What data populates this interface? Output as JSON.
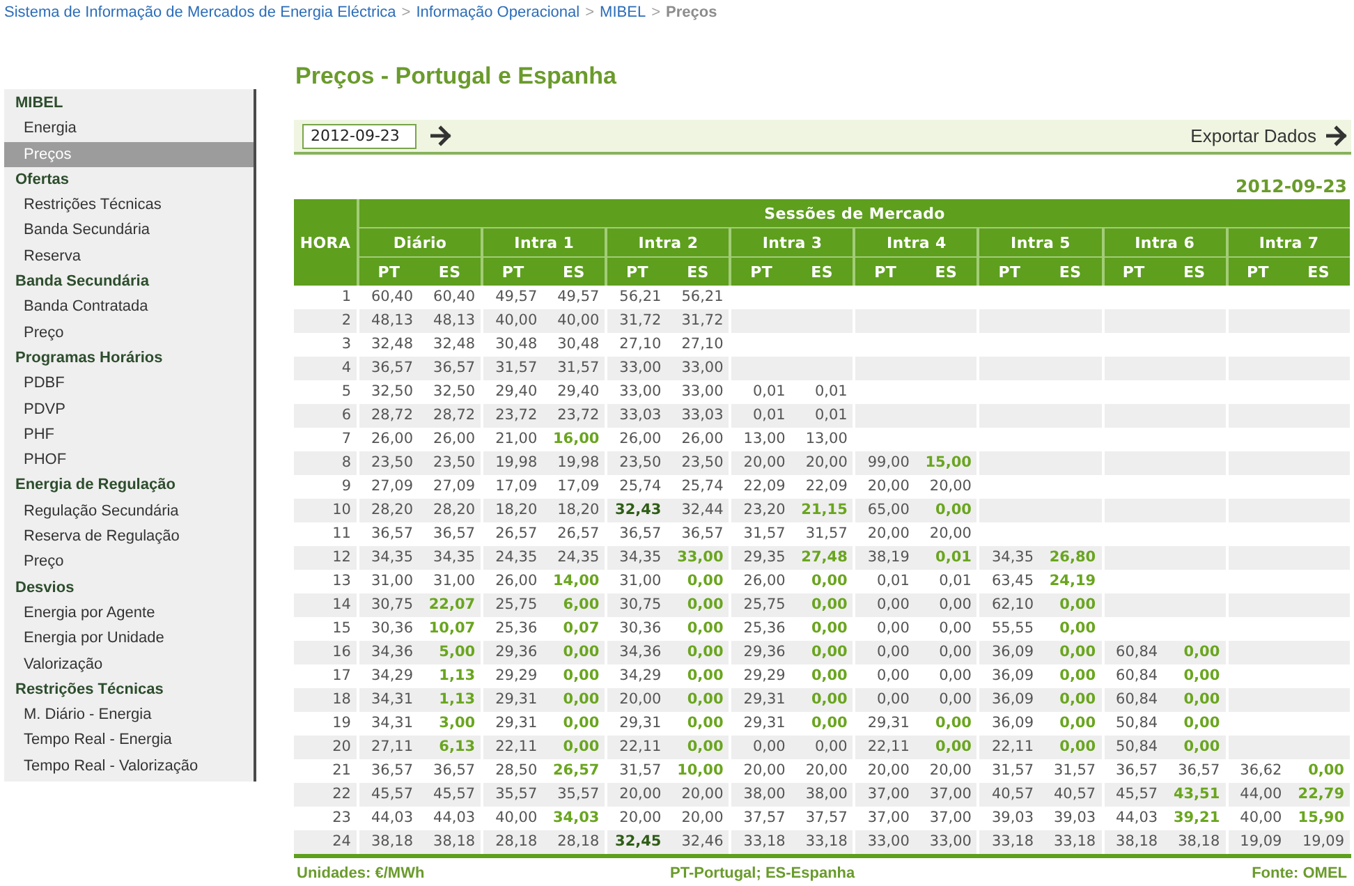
{
  "breadcrumb": [
    {
      "kind": "link",
      "label": "Sistema de Informação de Mercados de Energia Eléctrica"
    },
    {
      "kind": "separator",
      "label": ">"
    },
    {
      "kind": "link",
      "label": "Informação Operacional"
    },
    {
      "kind": "separator",
      "label": ">"
    },
    {
      "kind": "link",
      "label": "MIBEL"
    },
    {
      "kind": "separator",
      "label": ">"
    },
    {
      "kind": "current",
      "label": "Preços"
    }
  ],
  "sidebar": {
    "sections": [
      {
        "heading": "MIBEL",
        "items": [
          {
            "label": "Energia",
            "selected": false
          },
          {
            "label": "Preços",
            "selected": true
          }
        ]
      },
      {
        "heading": "Ofertas",
        "items": [
          {
            "label": "Restrições Técnicas",
            "selected": false
          },
          {
            "label": "Banda Secundária",
            "selected": false
          },
          {
            "label": "Reserva",
            "selected": false
          }
        ]
      },
      {
        "heading": "Banda Secundária",
        "items": [
          {
            "label": "Banda Contratada",
            "selected": false
          },
          {
            "label": "Preço",
            "selected": false
          }
        ]
      },
      {
        "heading": "Programas Horários",
        "items": [
          {
            "label": "PDBF",
            "selected": false
          },
          {
            "label": "PDVP",
            "selected": false
          },
          {
            "label": "PHF",
            "selected": false
          },
          {
            "label": "PHOF",
            "selected": false
          }
        ]
      },
      {
        "heading": "Energia de Regulação",
        "items": [
          {
            "label": "Regulação Secundária",
            "selected": false
          },
          {
            "label": "Reserva de Regulação",
            "selected": false
          },
          {
            "label": "Preço",
            "selected": false
          }
        ]
      },
      {
        "heading": "Desvios",
        "items": [
          {
            "label": "Energia por Agente",
            "selected": false
          },
          {
            "label": "Energia por Unidade",
            "selected": false
          },
          {
            "label": "Valorização",
            "selected": false
          }
        ]
      },
      {
        "heading": "Restrições Técnicas",
        "items": [
          {
            "label": "M. Diário - Energia",
            "selected": false
          },
          {
            "label": "Tempo Real - Energia",
            "selected": false
          },
          {
            "label": "Tempo Real - Valorização",
            "selected": false
          }
        ]
      }
    ]
  },
  "page_title": "Preços - Portugal e Espanha",
  "filter": {
    "date_field": {
      "value": "2012-09-23"
    },
    "export": {
      "label": "Exportar Dados"
    }
  },
  "table": {
    "date": "2012-09-23",
    "hour_header": "HORA",
    "group_header": "Sessões de Mercado",
    "sessions": [
      {
        "name": "Diário",
        "columns": [
          "PT",
          "ES"
        ]
      },
      {
        "name": "Intra 1",
        "columns": [
          "PT",
          "ES"
        ]
      },
      {
        "name": "Intra 2",
        "columns": [
          "PT",
          "ES"
        ]
      },
      {
        "name": "Intra 3",
        "columns": [
          "PT",
          "ES"
        ]
      },
      {
        "name": "Intra 4",
        "columns": [
          "PT",
          "ES"
        ]
      },
      {
        "name": "Intra 5",
        "columns": [
          "PT",
          "ES"
        ]
      },
      {
        "name": "Intra 6",
        "columns": [
          "PT",
          "ES"
        ]
      },
      {
        "name": "Intra 7",
        "columns": [
          "PT",
          "ES"
        ]
      }
    ],
    "rows": [
      {
        "hour": "1",
        "cells": [
          {
            "kind": "plain",
            "value": "60,40"
          },
          {
            "kind": "plain",
            "value": "60,40"
          },
          {
            "kind": "plain",
            "value": "49,57"
          },
          {
            "kind": "plain",
            "value": "49,57"
          },
          {
            "kind": "plain",
            "value": "56,21"
          },
          {
            "kind": "plain",
            "value": "56,21"
          }
        ]
      },
      {
        "hour": "2",
        "cells": [
          {
            "kind": "plain",
            "value": "48,13"
          },
          {
            "kind": "plain",
            "value": "48,13"
          },
          {
            "kind": "plain",
            "value": "40,00"
          },
          {
            "kind": "plain",
            "value": "40,00"
          },
          {
            "kind": "plain",
            "value": "31,72"
          },
          {
            "kind": "plain",
            "value": "31,72"
          }
        ]
      },
      {
        "hour": "3",
        "cells": [
          {
            "kind": "plain",
            "value": "32,48"
          },
          {
            "kind": "plain",
            "value": "32,48"
          },
          {
            "kind": "plain",
            "value": "30,48"
          },
          {
            "kind": "plain",
            "value": "30,48"
          },
          {
            "kind": "plain",
            "value": "27,10"
          },
          {
            "kind": "plain",
            "value": "27,10"
          }
        ]
      },
      {
        "hour": "4",
        "cells": [
          {
            "kind": "plain",
            "value": "36,57"
          },
          {
            "kind": "plain",
            "value": "36,57"
          },
          {
            "kind": "plain",
            "value": "31,57"
          },
          {
            "kind": "plain",
            "value": "31,57"
          },
          {
            "kind": "plain",
            "value": "33,00"
          },
          {
            "kind": "plain",
            "value": "33,00"
          }
        ]
      },
      {
        "hour": "5",
        "cells": [
          {
            "kind": "plain",
            "value": "32,50"
          },
          {
            "kind": "plain",
            "value": "32,50"
          },
          {
            "kind": "plain",
            "value": "29,40"
          },
          {
            "kind": "plain",
            "value": "29,40"
          },
          {
            "kind": "plain",
            "value": "33,00"
          },
          {
            "kind": "plain",
            "value": "33,00"
          },
          {
            "kind": "plain",
            "value": "0,01"
          },
          {
            "kind": "plain",
            "value": "0,01"
          }
        ]
      },
      {
        "hour": "6",
        "cells": [
          {
            "kind": "plain",
            "value": "28,72"
          },
          {
            "kind": "plain",
            "value": "28,72"
          },
          {
            "kind": "plain",
            "value": "23,72"
          },
          {
            "kind": "plain",
            "value": "23,72"
          },
          {
            "kind": "plain",
            "value": "33,03"
          },
          {
            "kind": "plain",
            "value": "33,03"
          },
          {
            "kind": "plain",
            "value": "0,01"
          },
          {
            "kind": "plain",
            "value": "0,01"
          }
        ]
      },
      {
        "hour": "7",
        "cells": [
          {
            "kind": "plain",
            "value": "26,00"
          },
          {
            "kind": "plain",
            "value": "26,00"
          },
          {
            "kind": "plain",
            "value": "21,00"
          },
          {
            "kind": "accent",
            "value": "16,00"
          },
          {
            "kind": "plain",
            "value": "26,00"
          },
          {
            "kind": "plain",
            "value": "26,00"
          },
          {
            "kind": "plain",
            "value": "13,00"
          },
          {
            "kind": "plain",
            "value": "13,00"
          }
        ]
      },
      {
        "hour": "8",
        "cells": [
          {
            "kind": "plain",
            "value": "23,50"
          },
          {
            "kind": "plain",
            "value": "23,50"
          },
          {
            "kind": "plain",
            "value": "19,98"
          },
          {
            "kind": "plain",
            "value": "19,98"
          },
          {
            "kind": "plain",
            "value": "23,50"
          },
          {
            "kind": "plain",
            "value": "23,50"
          },
          {
            "kind": "plain",
            "value": "20,00"
          },
          {
            "kind": "plain",
            "value": "20,00"
          },
          {
            "kind": "plain",
            "value": "99,00"
          },
          {
            "kind": "accent",
            "value": "15,00"
          }
        ]
      },
      {
        "hour": "9",
        "cells": [
          {
            "kind": "plain",
            "value": "27,09"
          },
          {
            "kind": "plain",
            "value": "27,09"
          },
          {
            "kind": "plain",
            "value": "17,09"
          },
          {
            "kind": "plain",
            "value": "17,09"
          },
          {
            "kind": "plain",
            "value": "25,74"
          },
          {
            "kind": "plain",
            "value": "25,74"
          },
          {
            "kind": "plain",
            "value": "22,09"
          },
          {
            "kind": "plain",
            "value": "22,09"
          },
          {
            "kind": "plain",
            "value": "20,00"
          },
          {
            "kind": "plain",
            "value": "20,00"
          }
        ]
      },
      {
        "hour": "10",
        "cells": [
          {
            "kind": "plain",
            "value": "28,20"
          },
          {
            "kind": "plain",
            "value": "28,20"
          },
          {
            "kind": "plain",
            "value": "18,20"
          },
          {
            "kind": "plain",
            "value": "18,20"
          },
          {
            "kind": "strong",
            "value": "32,43"
          },
          {
            "kind": "plain",
            "value": "32,44"
          },
          {
            "kind": "plain",
            "value": "23,20"
          },
          {
            "kind": "accent",
            "value": "21,15"
          },
          {
            "kind": "plain",
            "value": "65,00"
          },
          {
            "kind": "accent",
            "value": "0,00"
          }
        ]
      },
      {
        "hour": "11",
        "cells": [
          {
            "kind": "plain",
            "value": "36,57"
          },
          {
            "kind": "plain",
            "value": "36,57"
          },
          {
            "kind": "plain",
            "value": "26,57"
          },
          {
            "kind": "plain",
            "value": "26,57"
          },
          {
            "kind": "plain",
            "value": "36,57"
          },
          {
            "kind": "plain",
            "value": "36,57"
          },
          {
            "kind": "plain",
            "value": "31,57"
          },
          {
            "kind": "plain",
            "value": "31,57"
          },
          {
            "kind": "plain",
            "value": "20,00"
          },
          {
            "kind": "plain",
            "value": "20,00"
          }
        ]
      },
      {
        "hour": "12",
        "cells": [
          {
            "kind": "plain",
            "value": "34,35"
          },
          {
            "kind": "plain",
            "value": "34,35"
          },
          {
            "kind": "plain",
            "value": "24,35"
          },
          {
            "kind": "plain",
            "value": "24,35"
          },
          {
            "kind": "plain",
            "value": "34,35"
          },
          {
            "kind": "accent",
            "value": "33,00"
          },
          {
            "kind": "plain",
            "value": "29,35"
          },
          {
            "kind": "accent",
            "value": "27,48"
          },
          {
            "kind": "plain",
            "value": "38,19"
          },
          {
            "kind": "accent",
            "value": "0,01"
          },
          {
            "kind": "plain",
            "value": "34,35"
          },
          {
            "kind": "accent",
            "value": "26,80"
          }
        ]
      },
      {
        "hour": "13",
        "cells": [
          {
            "kind": "plain",
            "value": "31,00"
          },
          {
            "kind": "plain",
            "value": "31,00"
          },
          {
            "kind": "plain",
            "value": "26,00"
          },
          {
            "kind": "accent",
            "value": "14,00"
          },
          {
            "kind": "plain",
            "value": "31,00"
          },
          {
            "kind": "accent",
            "value": "0,00"
          },
          {
            "kind": "plain",
            "value": "26,00"
          },
          {
            "kind": "accent",
            "value": "0,00"
          },
          {
            "kind": "plain",
            "value": "0,01"
          },
          {
            "kind": "plain",
            "value": "0,01"
          },
          {
            "kind": "plain",
            "value": "63,45"
          },
          {
            "kind": "accent",
            "value": "24,19"
          }
        ]
      },
      {
        "hour": "14",
        "cells": [
          {
            "kind": "plain",
            "value": "30,75"
          },
          {
            "kind": "accent",
            "value": "22,07"
          },
          {
            "kind": "plain",
            "value": "25,75"
          },
          {
            "kind": "accent",
            "value": "6,00"
          },
          {
            "kind": "plain",
            "value": "30,75"
          },
          {
            "kind": "accent",
            "value": "0,00"
          },
          {
            "kind": "plain",
            "value": "25,75"
          },
          {
            "kind": "accent",
            "value": "0,00"
          },
          {
            "kind": "plain",
            "value": "0,00"
          },
          {
            "kind": "plain",
            "value": "0,00"
          },
          {
            "kind": "plain",
            "value": "62,10"
          },
          {
            "kind": "accent",
            "value": "0,00"
          }
        ]
      },
      {
        "hour": "15",
        "cells": [
          {
            "kind": "plain",
            "value": "30,36"
          },
          {
            "kind": "accent",
            "value": "10,07"
          },
          {
            "kind": "plain",
            "value": "25,36"
          },
          {
            "kind": "accent",
            "value": "0,07"
          },
          {
            "kind": "plain",
            "value": "30,36"
          },
          {
            "kind": "accent",
            "value": "0,00"
          },
          {
            "kind": "plain",
            "value": "25,36"
          },
          {
            "kind": "accent",
            "value": "0,00"
          },
          {
            "kind": "plain",
            "value": "0,00"
          },
          {
            "kind": "plain",
            "value": "0,00"
          },
          {
            "kind": "plain",
            "value": "55,55"
          },
          {
            "kind": "accent",
            "value": "0,00"
          }
        ]
      },
      {
        "hour": "16",
        "cells": [
          {
            "kind": "plain",
            "value": "34,36"
          },
          {
            "kind": "accent",
            "value": "5,00"
          },
          {
            "kind": "plain",
            "value": "29,36"
          },
          {
            "kind": "accent",
            "value": "0,00"
          },
          {
            "kind": "plain",
            "value": "34,36"
          },
          {
            "kind": "accent",
            "value": "0,00"
          },
          {
            "kind": "plain",
            "value": "29,36"
          },
          {
            "kind": "accent",
            "value": "0,00"
          },
          {
            "kind": "plain",
            "value": "0,00"
          },
          {
            "kind": "plain",
            "value": "0,00"
          },
          {
            "kind": "plain",
            "value": "36,09"
          },
          {
            "kind": "accent",
            "value": "0,00"
          },
          {
            "kind": "plain",
            "value": "60,84"
          },
          {
            "kind": "accent",
            "value": "0,00"
          }
        ]
      },
      {
        "hour": "17",
        "cells": [
          {
            "kind": "plain",
            "value": "34,29"
          },
          {
            "kind": "accent",
            "value": "1,13"
          },
          {
            "kind": "plain",
            "value": "29,29"
          },
          {
            "kind": "accent",
            "value": "0,00"
          },
          {
            "kind": "plain",
            "value": "34,29"
          },
          {
            "kind": "accent",
            "value": "0,00"
          },
          {
            "kind": "plain",
            "value": "29,29"
          },
          {
            "kind": "accent",
            "value": "0,00"
          },
          {
            "kind": "plain",
            "value": "0,00"
          },
          {
            "kind": "plain",
            "value": "0,00"
          },
          {
            "kind": "plain",
            "value": "36,09"
          },
          {
            "kind": "accent",
            "value": "0,00"
          },
          {
            "kind": "plain",
            "value": "60,84"
          },
          {
            "kind": "accent",
            "value": "0,00"
          }
        ]
      },
      {
        "hour": "18",
        "cells": [
          {
            "kind": "plain",
            "value": "34,31"
          },
          {
            "kind": "accent",
            "value": "1,13"
          },
          {
            "kind": "plain",
            "value": "29,31"
          },
          {
            "kind": "accent",
            "value": "0,00"
          },
          {
            "kind": "plain",
            "value": "20,00"
          },
          {
            "kind": "accent",
            "value": "0,00"
          },
          {
            "kind": "plain",
            "value": "29,31"
          },
          {
            "kind": "accent",
            "value": "0,00"
          },
          {
            "kind": "plain",
            "value": "0,00"
          },
          {
            "kind": "plain",
            "value": "0,00"
          },
          {
            "kind": "plain",
            "value": "36,09"
          },
          {
            "kind": "accent",
            "value": "0,00"
          },
          {
            "kind": "plain",
            "value": "60,84"
          },
          {
            "kind": "accent",
            "value": "0,00"
          }
        ]
      },
      {
        "hour": "19",
        "cells": [
          {
            "kind": "plain",
            "value": "34,31"
          },
          {
            "kind": "accent",
            "value": "3,00"
          },
          {
            "kind": "plain",
            "value": "29,31"
          },
          {
            "kind": "accent",
            "value": "0,00"
          },
          {
            "kind": "plain",
            "value": "29,31"
          },
          {
            "kind": "accent",
            "value": "0,00"
          },
          {
            "kind": "plain",
            "value": "29,31"
          },
          {
            "kind": "accent",
            "value": "0,00"
          },
          {
            "kind": "plain",
            "value": "29,31"
          },
          {
            "kind": "accent",
            "value": "0,00"
          },
          {
            "kind": "plain",
            "value": "36,09"
          },
          {
            "kind": "accent",
            "value": "0,00"
          },
          {
            "kind": "plain",
            "value": "50,84"
          },
          {
            "kind": "accent",
            "value": "0,00"
          }
        ]
      },
      {
        "hour": "20",
        "cells": [
          {
            "kind": "plain",
            "value": "27,11"
          },
          {
            "kind": "accent",
            "value": "6,13"
          },
          {
            "kind": "plain",
            "value": "22,11"
          },
          {
            "kind": "accent",
            "value": "0,00"
          },
          {
            "kind": "plain",
            "value": "22,11"
          },
          {
            "kind": "accent",
            "value": "0,00"
          },
          {
            "kind": "plain",
            "value": "0,00"
          },
          {
            "kind": "plain",
            "value": "0,00"
          },
          {
            "kind": "plain",
            "value": "22,11"
          },
          {
            "kind": "accent",
            "value": "0,00"
          },
          {
            "kind": "plain",
            "value": "22,11"
          },
          {
            "kind": "accent",
            "value": "0,00"
          },
          {
            "kind": "plain",
            "value": "50,84"
          },
          {
            "kind": "accent",
            "value": "0,00"
          }
        ]
      },
      {
        "hour": "21",
        "cells": [
          {
            "kind": "plain",
            "value": "36,57"
          },
          {
            "kind": "plain",
            "value": "36,57"
          },
          {
            "kind": "plain",
            "value": "28,50"
          },
          {
            "kind": "accent",
            "value": "26,57"
          },
          {
            "kind": "plain",
            "value": "31,57"
          },
          {
            "kind": "accent",
            "value": "10,00"
          },
          {
            "kind": "plain",
            "value": "20,00"
          },
          {
            "kind": "plain",
            "value": "20,00"
          },
          {
            "kind": "plain",
            "value": "20,00"
          },
          {
            "kind": "plain",
            "value": "20,00"
          },
          {
            "kind": "plain",
            "value": "31,57"
          },
          {
            "kind": "plain",
            "value": "31,57"
          },
          {
            "kind": "plain",
            "value": "36,57"
          },
          {
            "kind": "plain",
            "value": "36,57"
          },
          {
            "kind": "plain",
            "value": "36,62"
          },
          {
            "kind": "accent",
            "value": "0,00"
          }
        ]
      },
      {
        "hour": "22",
        "cells": [
          {
            "kind": "plain",
            "value": "45,57"
          },
          {
            "kind": "plain",
            "value": "45,57"
          },
          {
            "kind": "plain",
            "value": "35,57"
          },
          {
            "kind": "plain",
            "value": "35,57"
          },
          {
            "kind": "plain",
            "value": "20,00"
          },
          {
            "kind": "plain",
            "value": "20,00"
          },
          {
            "kind": "plain",
            "value": "38,00"
          },
          {
            "kind": "plain",
            "value": "38,00"
          },
          {
            "kind": "plain",
            "value": "37,00"
          },
          {
            "kind": "plain",
            "value": "37,00"
          },
          {
            "kind": "plain",
            "value": "40,57"
          },
          {
            "kind": "plain",
            "value": "40,57"
          },
          {
            "kind": "plain",
            "value": "45,57"
          },
          {
            "kind": "accent",
            "value": "43,51"
          },
          {
            "kind": "plain",
            "value": "44,00"
          },
          {
            "kind": "accent",
            "value": "22,79"
          }
        ]
      },
      {
        "hour": "23",
        "cells": [
          {
            "kind": "plain",
            "value": "44,03"
          },
          {
            "kind": "plain",
            "value": "44,03"
          },
          {
            "kind": "plain",
            "value": "40,00"
          },
          {
            "kind": "accent",
            "value": "34,03"
          },
          {
            "kind": "plain",
            "value": "20,00"
          },
          {
            "kind": "plain",
            "value": "20,00"
          },
          {
            "kind": "plain",
            "value": "37,57"
          },
          {
            "kind": "plain",
            "value": "37,57"
          },
          {
            "kind": "plain",
            "value": "37,00"
          },
          {
            "kind": "plain",
            "value": "37,00"
          },
          {
            "kind": "plain",
            "value": "39,03"
          },
          {
            "kind": "plain",
            "value": "39,03"
          },
          {
            "kind": "plain",
            "value": "44,03"
          },
          {
            "kind": "accent",
            "value": "39,21"
          },
          {
            "kind": "plain",
            "value": "40,00"
          },
          {
            "kind": "accent",
            "value": "15,90"
          }
        ]
      },
      {
        "hour": "24",
        "cells": [
          {
            "kind": "plain",
            "value": "38,18"
          },
          {
            "kind": "plain",
            "value": "38,18"
          },
          {
            "kind": "plain",
            "value": "28,18"
          },
          {
            "kind": "plain",
            "value": "28,18"
          },
          {
            "kind": "strong",
            "value": "32,45"
          },
          {
            "kind": "plain",
            "value": "32,46"
          },
          {
            "kind": "plain",
            "value": "33,18"
          },
          {
            "kind": "plain",
            "value": "33,18"
          },
          {
            "kind": "plain",
            "value": "33,00"
          },
          {
            "kind": "plain",
            "value": "33,00"
          },
          {
            "kind": "plain",
            "value": "33,18"
          },
          {
            "kind": "plain",
            "value": "33,18"
          },
          {
            "kind": "plain",
            "value": "38,18"
          },
          {
            "kind": "plain",
            "value": "38,18"
          },
          {
            "kind": "plain",
            "value": "19,09"
          },
          {
            "kind": "plain",
            "value": "19,09"
          }
        ]
      }
    ]
  },
  "footer": {
    "units": "Unidades: €/MWh",
    "legend": "PT-Portugal; ES-Espanha",
    "source": "Fonte: OMEL"
  }
}
